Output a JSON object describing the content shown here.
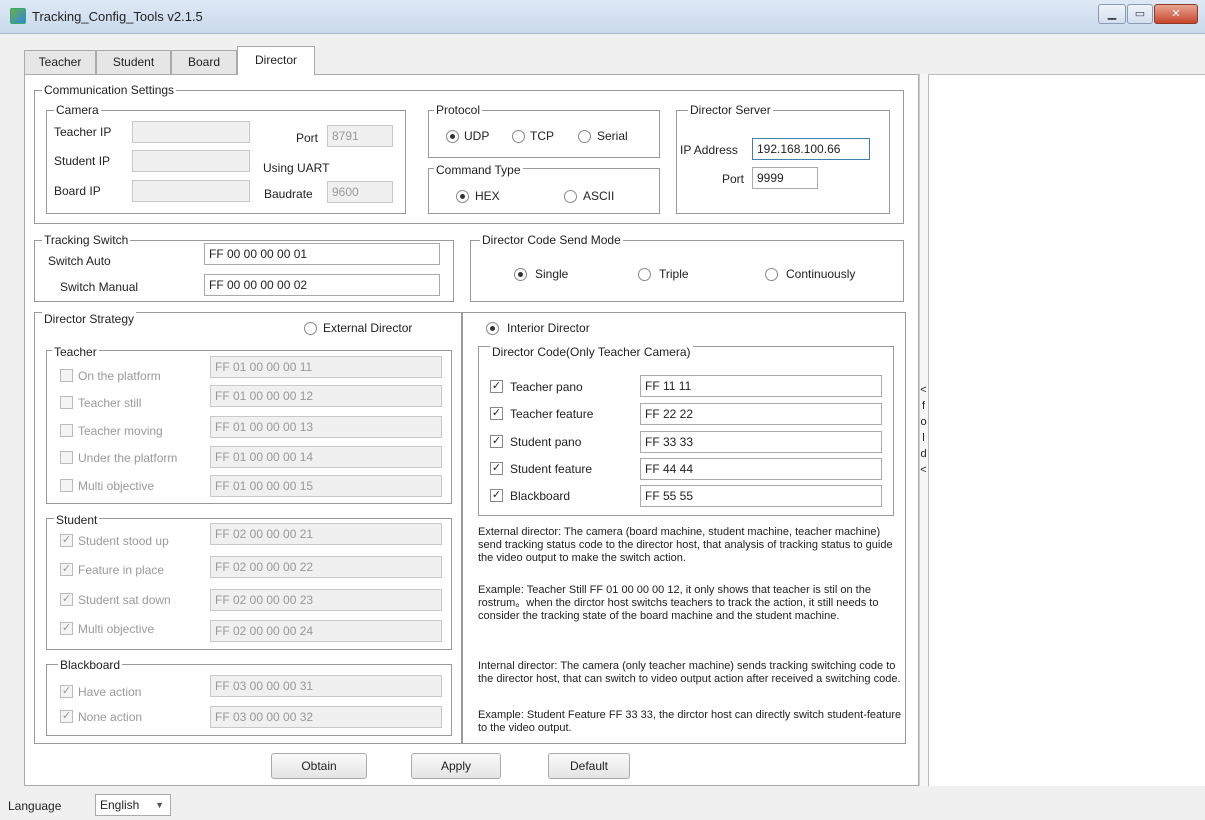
{
  "window": {
    "title": "Tracking_Config_Tools v2.1.5",
    "min_label": "▁",
    "max_label": "▭",
    "close_label": "✕"
  },
  "tabs": [
    "Teacher",
    "Student",
    "Board",
    "Director"
  ],
  "comm": {
    "title": "Communication Settings",
    "camera": {
      "title": "Camera",
      "teacher_ip_label": "Teacher IP",
      "teacher_ip": "",
      "student_ip_label": "Student IP",
      "student_ip": "",
      "board_ip_label": "Board IP",
      "board_ip": "",
      "port_label": "Port",
      "port": "8791",
      "using_uart": "Using UART",
      "baudrate_label": "Baudrate",
      "baudrate": "9600"
    },
    "protocol": {
      "title": "Protocol",
      "options": [
        "UDP",
        "TCP",
        "Serial"
      ],
      "selected": "UDP"
    },
    "command_type": {
      "title": "Command Type",
      "options": [
        "HEX",
        "ASCII"
      ],
      "selected": "HEX"
    },
    "director_server": {
      "title": "Director Server",
      "ip_label": "IP Address",
      "ip": "192.168.100.66",
      "port_label": "Port",
      "port": "9999"
    }
  },
  "tracking_switch": {
    "title": "Tracking Switch",
    "auto_label": "Switch Auto",
    "auto_code": "FF 00 00 00 00 01",
    "manual_label": "Switch Manual",
    "manual_code": "FF 00 00 00 00 02"
  },
  "send_mode": {
    "title": "Director Code Send Mode",
    "options": [
      "Single",
      "Triple",
      "Continuously"
    ],
    "selected": "Single"
  },
  "strategy": {
    "title": "Director Strategy",
    "external_label": "External Director",
    "teacher": {
      "title": "Teacher",
      "items": [
        {
          "label": "On the platform",
          "code": "FF 01 00 00 00 11"
        },
        {
          "label": "Teacher still",
          "code": "FF 01 00 00 00 12"
        },
        {
          "label": "Teacher moving",
          "code": "FF 01 00 00 00 13"
        },
        {
          "label": "Under the platform",
          "code": "FF 01 00 00 00 14"
        },
        {
          "label": "Multi objective",
          "code": "FF 01 00 00 00 15"
        }
      ]
    },
    "student": {
      "title": "Student",
      "items": [
        {
          "label": "Student stood up",
          "code": "FF 02 00 00 00 21"
        },
        {
          "label": "Feature in place",
          "code": "FF 02 00 00 00 22"
        },
        {
          "label": "Student sat down",
          "code": "FF 02 00 00 00 23"
        },
        {
          "label": "Multi objective",
          "code": "FF 02 00 00 00 24"
        }
      ]
    },
    "blackboard": {
      "title": "Blackboard",
      "items": [
        {
          "label": "Have action",
          "code": "FF 03 00 00 00 31"
        },
        {
          "label": "None action",
          "code": "FF 03 00 00 00 32"
        }
      ]
    }
  },
  "interior": {
    "label": "Interior Director",
    "code_title": "Director Code(Only Teacher Camera)",
    "items": [
      {
        "label": "Teacher pano",
        "code": "FF 11 11"
      },
      {
        "label": "Teacher feature",
        "code": "FF 22 22"
      },
      {
        "label": "Student pano",
        "code": "FF 33 33"
      },
      {
        "label": "Student feature",
        "code": "FF 44 44"
      },
      {
        "label": "Blackboard",
        "code": "FF 55 55"
      }
    ],
    "notes": {
      "external": "External director: The camera (board machine, student machine, teacher machine) send tracking status code to the director host, that analysis of tracking status to guide the video output to make the switch action.",
      "external_example": "Example: Teacher Still FF 01 00 00 00 12, it only shows that teacher is stil on the rostrum。when the dirctor host switchs teachers to track the action, it still needs to consider the tracking state of the board machine and the student machine.",
      "internal": "Internal director: The camera (only teacher machine) sends tracking switching code to the director host, that can switch to video output action after received a switching code.",
      "internal_example": "Example: Student Feature FF 33 33, the dirctor host can directly switch student-feature to the video output."
    }
  },
  "collapse_strip": [
    "<",
    "f",
    "o",
    "l",
    "d",
    "<"
  ],
  "buttons": {
    "obtain": "Obtain",
    "apply": "Apply",
    "default": "Default"
  },
  "language": {
    "label": "Language",
    "value": "English"
  }
}
